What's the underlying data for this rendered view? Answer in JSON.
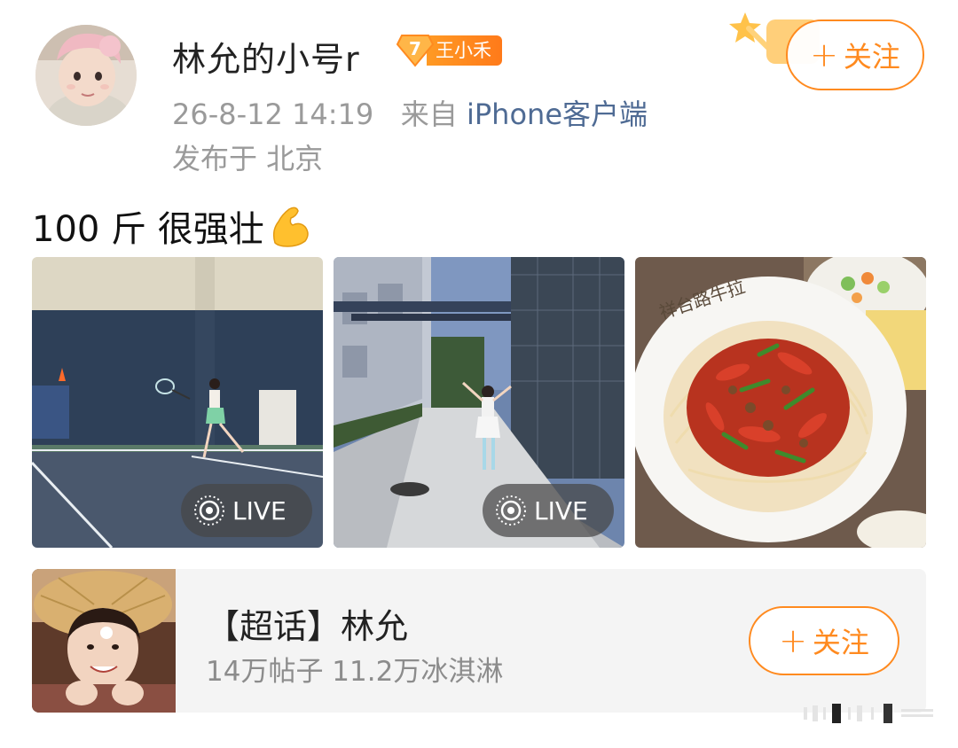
{
  "post": {
    "username": "林允的小号r",
    "badge_level": "7",
    "badge_name": "王小禾",
    "timestamp": "26-8-12 14:19",
    "from_prefix": "来自",
    "source": "iPhone客户端",
    "location": "发布于 北京",
    "follow_label": "关注",
    "text": "100 斤 很强壮",
    "emoji": "muscle-emoji"
  },
  "photos": [
    {
      "name": "tennis-court-photo",
      "live_label": "LIVE"
    },
    {
      "name": "alley-photo",
      "live_label": "LIVE"
    },
    {
      "name": "noodles-photo",
      "sign_text": "祥台路牛拉"
    }
  ],
  "topic": {
    "title": "【超话】林允",
    "stats": "14万帖子 11.2万冰淇淋",
    "follow_label": "关注"
  },
  "colors": {
    "accent": "#ff8a1f",
    "link": "#4f6b94",
    "muted": "#9a9a9a"
  }
}
